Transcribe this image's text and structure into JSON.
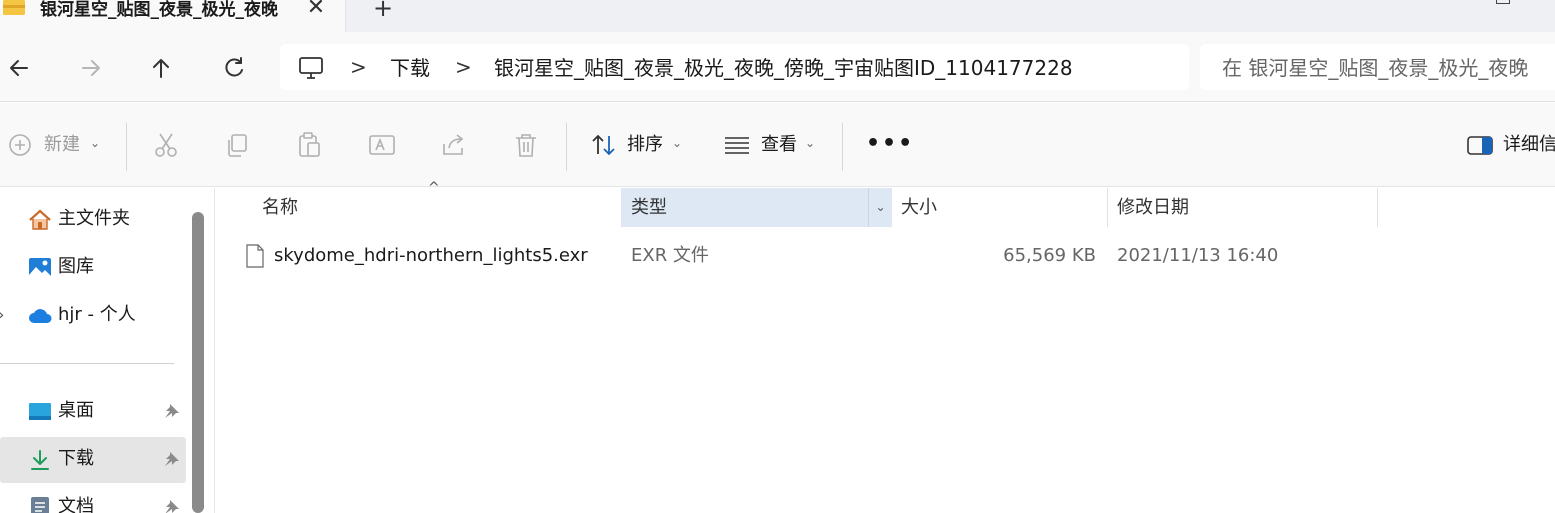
{
  "tab": {
    "title": "银河星空_贴图_夜景_极光_夜晚",
    "close_glyph": "✕",
    "new_tab_glyph": "+"
  },
  "nav": {
    "breadcrumbs": [
      "下载",
      "银河星空_贴图_夜景_极光_夜晚_傍晚_宇宙贴图ID_1104177228"
    ],
    "separator": ">",
    "search_placeholder": "在 银河星空_贴图_夜景_极光_夜晚"
  },
  "commands": {
    "new_label": "新建",
    "sort_label": "排序",
    "view_label": "查看",
    "more_label": "•••",
    "details_label": "详细信"
  },
  "sidebar": {
    "items": [
      {
        "label": "主文件夹",
        "icon": "home-icon"
      },
      {
        "label": "图库",
        "icon": "gallery-icon"
      },
      {
        "label": "hjr - 个人",
        "icon": "onedrive-icon"
      },
      {
        "label": "桌面",
        "icon": "desktop-icon"
      },
      {
        "label": "下载",
        "icon": "download-icon"
      },
      {
        "label": "文档",
        "icon": "documents-icon"
      }
    ]
  },
  "columns": {
    "name": "名称",
    "type": "类型",
    "size": "大小",
    "modified": "修改日期"
  },
  "files": [
    {
      "name": "skydome_hdri-northern_lights5.exr",
      "type": "EXR 文件",
      "size": "65,569 KB",
      "modified": "2021/11/13 16:40"
    }
  ],
  "colors": {
    "accent": "#0067c0",
    "selected_header": "#dde8f4",
    "selected_item": "#e5e5e5"
  }
}
